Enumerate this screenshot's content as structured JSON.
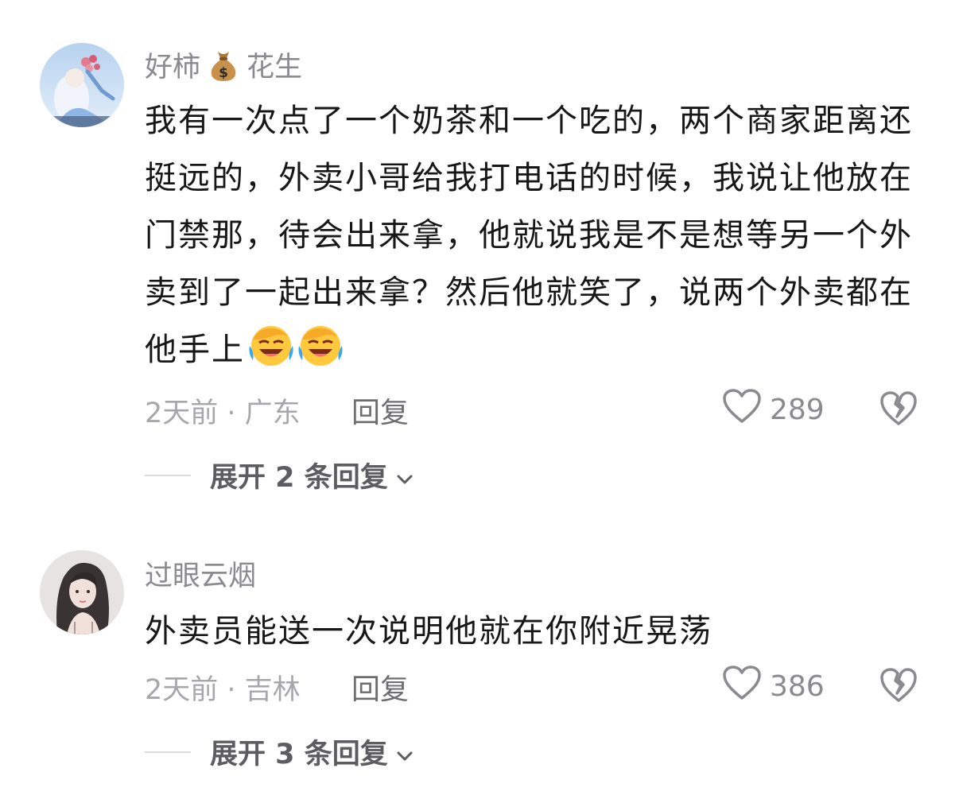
{
  "comments": [
    {
      "username": "好柿",
      "badge_icon": "money-bag-icon",
      "badge_label": "花生",
      "text": "我有一次点了一个奶茶和一个吃的，两个商家距离还挺远的，外卖小哥给我打电话的时候，我说让他放在门禁那，待会出来拿，他就说我是不是想等另一个外卖到了一起出来拿？然后他就笑了，说两个外卖都在他手上",
      "emojis": [
        "laughing-crying-emoji",
        "laughing-crying-emoji"
      ],
      "time_location": "2天前 · 广东",
      "reply_label": "回复",
      "like_count": "289",
      "expand_label": "展开 2 条回复"
    },
    {
      "username": "过眼云烟",
      "text": "外卖员能送一次说明他就在你附近晃荡",
      "time_location": "2天前 · 吉林",
      "reply_label": "回复",
      "like_count": "386",
      "expand_label": "展开 3 条回复"
    }
  ],
  "colors": {
    "username": "#8a8a8f",
    "text": "#171717",
    "meta": "#a7a7ab",
    "expand": "#5c5c61"
  }
}
